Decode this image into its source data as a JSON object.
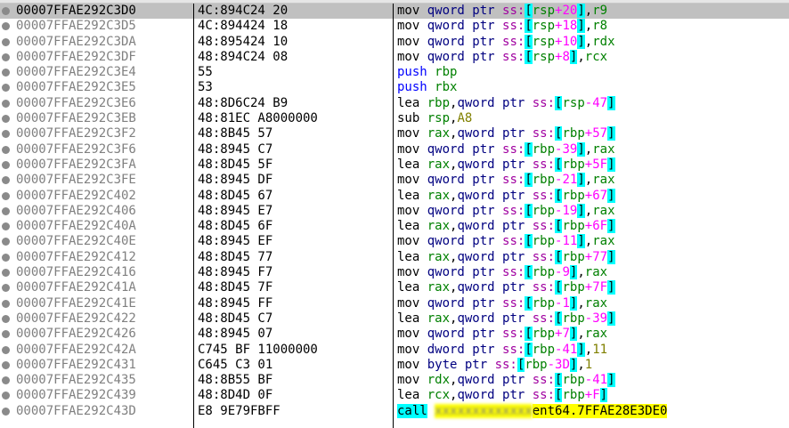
{
  "rows": [
    {
      "addr": "00007FFAE292C3D0",
      "bytes": "4C:894C24 20",
      "instr": [
        [
          "op-mov",
          "mov "
        ],
        [
          "kw",
          "qword ptr "
        ],
        [
          "seg",
          "ss:"
        ],
        [
          "br",
          "["
        ],
        [
          "reg",
          "rsp"
        ],
        [
          "off",
          "+20"
        ],
        [
          "br",
          "]"
        ],
        [
          "",
          ","
        ],
        [
          "reg",
          "r9"
        ]
      ],
      "selected": true
    },
    {
      "addr": "00007FFAE292C3D5",
      "bytes": "4C:894424 18",
      "instr": [
        [
          "op-mov",
          "mov "
        ],
        [
          "kw",
          "qword ptr "
        ],
        [
          "seg",
          "ss:"
        ],
        [
          "br",
          "["
        ],
        [
          "reg",
          "rsp"
        ],
        [
          "off",
          "+18"
        ],
        [
          "br",
          "]"
        ],
        [
          "",
          ","
        ],
        [
          "reg",
          "r8"
        ]
      ]
    },
    {
      "addr": "00007FFAE292C3DA",
      "bytes": "48:895424 10",
      "instr": [
        [
          "op-mov",
          "mov "
        ],
        [
          "kw",
          "qword ptr "
        ],
        [
          "seg",
          "ss:"
        ],
        [
          "br",
          "["
        ],
        [
          "reg",
          "rsp"
        ],
        [
          "off",
          "+10"
        ],
        [
          "br",
          "]"
        ],
        [
          "",
          ","
        ],
        [
          "reg",
          "rdx"
        ]
      ]
    },
    {
      "addr": "00007FFAE292C3DF",
      "bytes": "48:894C24 08",
      "instr": [
        [
          "op-mov",
          "mov "
        ],
        [
          "kw",
          "qword ptr "
        ],
        [
          "seg",
          "ss:"
        ],
        [
          "br",
          "["
        ],
        [
          "reg",
          "rsp"
        ],
        [
          "off",
          "+8"
        ],
        [
          "br",
          "]"
        ],
        [
          "",
          ","
        ],
        [
          "reg",
          "rcx"
        ]
      ]
    },
    {
      "addr": "00007FFAE292C3E4",
      "bytes": "55",
      "instr": [
        [
          "op-push",
          "push "
        ],
        [
          "reg",
          "rbp"
        ]
      ]
    },
    {
      "addr": "00007FFAE292C3E5",
      "bytes": "53",
      "instr": [
        [
          "op-push",
          "push "
        ],
        [
          "reg",
          "rbx"
        ]
      ]
    },
    {
      "addr": "00007FFAE292C3E6",
      "bytes": "48:8D6C24 B9",
      "instr": [
        [
          "op-mov",
          "lea "
        ],
        [
          "reg",
          "rbp"
        ],
        [
          "",
          ","
        ],
        [
          "kw",
          "qword ptr "
        ],
        [
          "seg",
          "ss:"
        ],
        [
          "br",
          "["
        ],
        [
          "reg",
          "rsp"
        ],
        [
          "off",
          "-47"
        ],
        [
          "br",
          "]"
        ]
      ]
    },
    {
      "addr": "00007FFAE292C3EB",
      "bytes": "48:81EC A8000000",
      "instr": [
        [
          "op-mov",
          "sub "
        ],
        [
          "reg",
          "rsp"
        ],
        [
          "",
          ","
        ],
        [
          "imm",
          "A8"
        ]
      ]
    },
    {
      "addr": "00007FFAE292C3F2",
      "bytes": "48:8B45 57",
      "instr": [
        [
          "op-mov",
          "mov "
        ],
        [
          "reg",
          "rax"
        ],
        [
          "",
          ","
        ],
        [
          "kw",
          "qword ptr "
        ],
        [
          "seg",
          "ss:"
        ],
        [
          "br",
          "["
        ],
        [
          "reg",
          "rbp"
        ],
        [
          "off",
          "+57"
        ],
        [
          "br",
          "]"
        ]
      ]
    },
    {
      "addr": "00007FFAE292C3F6",
      "bytes": "48:8945 C7",
      "instr": [
        [
          "op-mov",
          "mov "
        ],
        [
          "kw",
          "qword ptr "
        ],
        [
          "seg",
          "ss:"
        ],
        [
          "br",
          "["
        ],
        [
          "reg",
          "rbp"
        ],
        [
          "off",
          "-39"
        ],
        [
          "br",
          "]"
        ],
        [
          "",
          ","
        ],
        [
          "reg",
          "rax"
        ]
      ]
    },
    {
      "addr": "00007FFAE292C3FA",
      "bytes": "48:8D45 5F",
      "instr": [
        [
          "op-mov",
          "lea "
        ],
        [
          "reg",
          "rax"
        ],
        [
          "",
          ","
        ],
        [
          "kw",
          "qword ptr "
        ],
        [
          "seg",
          "ss:"
        ],
        [
          "br",
          "["
        ],
        [
          "reg",
          "rbp"
        ],
        [
          "off",
          "+5F"
        ],
        [
          "br",
          "]"
        ]
      ]
    },
    {
      "addr": "00007FFAE292C3FE",
      "bytes": "48:8945 DF",
      "instr": [
        [
          "op-mov",
          "mov "
        ],
        [
          "kw",
          "qword ptr "
        ],
        [
          "seg",
          "ss:"
        ],
        [
          "br",
          "["
        ],
        [
          "reg",
          "rbp"
        ],
        [
          "off",
          "-21"
        ],
        [
          "br",
          "]"
        ],
        [
          "",
          ","
        ],
        [
          "reg",
          "rax"
        ]
      ]
    },
    {
      "addr": "00007FFAE292C402",
      "bytes": "48:8D45 67",
      "instr": [
        [
          "op-mov",
          "lea "
        ],
        [
          "reg",
          "rax"
        ],
        [
          "",
          ","
        ],
        [
          "kw",
          "qword ptr "
        ],
        [
          "seg",
          "ss:"
        ],
        [
          "br",
          "["
        ],
        [
          "reg",
          "rbp"
        ],
        [
          "off",
          "+67"
        ],
        [
          "br",
          "]"
        ]
      ]
    },
    {
      "addr": "00007FFAE292C406",
      "bytes": "48:8945 E7",
      "instr": [
        [
          "op-mov",
          "mov "
        ],
        [
          "kw",
          "qword ptr "
        ],
        [
          "seg",
          "ss:"
        ],
        [
          "br",
          "["
        ],
        [
          "reg",
          "rbp"
        ],
        [
          "off",
          "-19"
        ],
        [
          "br",
          "]"
        ],
        [
          "",
          ","
        ],
        [
          "reg",
          "rax"
        ]
      ]
    },
    {
      "addr": "00007FFAE292C40A",
      "bytes": "48:8D45 6F",
      "instr": [
        [
          "op-mov",
          "lea "
        ],
        [
          "reg",
          "rax"
        ],
        [
          "",
          ","
        ],
        [
          "kw",
          "qword ptr "
        ],
        [
          "seg",
          "ss:"
        ],
        [
          "br",
          "["
        ],
        [
          "reg",
          "rbp"
        ],
        [
          "off",
          "+6F"
        ],
        [
          "br",
          "]"
        ]
      ]
    },
    {
      "addr": "00007FFAE292C40E",
      "bytes": "48:8945 EF",
      "instr": [
        [
          "op-mov",
          "mov "
        ],
        [
          "kw",
          "qword ptr "
        ],
        [
          "seg",
          "ss:"
        ],
        [
          "br",
          "["
        ],
        [
          "reg",
          "rbp"
        ],
        [
          "off",
          "-11"
        ],
        [
          "br",
          "]"
        ],
        [
          "",
          ","
        ],
        [
          "reg",
          "rax"
        ]
      ]
    },
    {
      "addr": "00007FFAE292C412",
      "bytes": "48:8D45 77",
      "instr": [
        [
          "op-mov",
          "lea "
        ],
        [
          "reg",
          "rax"
        ],
        [
          "",
          ","
        ],
        [
          "kw",
          "qword ptr "
        ],
        [
          "seg",
          "ss:"
        ],
        [
          "br",
          "["
        ],
        [
          "reg",
          "rbp"
        ],
        [
          "off",
          "+77"
        ],
        [
          "br",
          "]"
        ]
      ]
    },
    {
      "addr": "00007FFAE292C416",
      "bytes": "48:8945 F7",
      "instr": [
        [
          "op-mov",
          "mov "
        ],
        [
          "kw",
          "qword ptr "
        ],
        [
          "seg",
          "ss:"
        ],
        [
          "br",
          "["
        ],
        [
          "reg",
          "rbp"
        ],
        [
          "off",
          "-9"
        ],
        [
          "br",
          "]"
        ],
        [
          "",
          ","
        ],
        [
          "reg",
          "rax"
        ]
      ]
    },
    {
      "addr": "00007FFAE292C41A",
      "bytes": "48:8D45 7F",
      "instr": [
        [
          "op-mov",
          "lea "
        ],
        [
          "reg",
          "rax"
        ],
        [
          "",
          ","
        ],
        [
          "kw",
          "qword ptr "
        ],
        [
          "seg",
          "ss:"
        ],
        [
          "br",
          "["
        ],
        [
          "reg",
          "rbp"
        ],
        [
          "off",
          "+7F"
        ],
        [
          "br",
          "]"
        ]
      ]
    },
    {
      "addr": "00007FFAE292C41E",
      "bytes": "48:8945 FF",
      "instr": [
        [
          "op-mov",
          "mov "
        ],
        [
          "kw",
          "qword ptr "
        ],
        [
          "seg",
          "ss:"
        ],
        [
          "br",
          "["
        ],
        [
          "reg",
          "rbp"
        ],
        [
          "off",
          "-1"
        ],
        [
          "br",
          "]"
        ],
        [
          "",
          ","
        ],
        [
          "reg",
          "rax"
        ]
      ]
    },
    {
      "addr": "00007FFAE292C422",
      "bytes": "48:8D45 C7",
      "instr": [
        [
          "op-mov",
          "lea "
        ],
        [
          "reg",
          "rax"
        ],
        [
          "",
          ","
        ],
        [
          "kw",
          "qword ptr "
        ],
        [
          "seg",
          "ss:"
        ],
        [
          "br",
          "["
        ],
        [
          "reg",
          "rbp"
        ],
        [
          "off",
          "-39"
        ],
        [
          "br",
          "]"
        ]
      ]
    },
    {
      "addr": "00007FFAE292C426",
      "bytes": "48:8945 07",
      "instr": [
        [
          "op-mov",
          "mov "
        ],
        [
          "kw",
          "qword ptr "
        ],
        [
          "seg",
          "ss:"
        ],
        [
          "br",
          "["
        ],
        [
          "reg",
          "rbp"
        ],
        [
          "off",
          "+7"
        ],
        [
          "br",
          "]"
        ],
        [
          "",
          ","
        ],
        [
          "reg",
          "rax"
        ]
      ]
    },
    {
      "addr": "00007FFAE292C42A",
      "bytes": "C745 BF 11000000",
      "instr": [
        [
          "op-mov",
          "mov "
        ],
        [
          "kw",
          "dword ptr "
        ],
        [
          "seg",
          "ss:"
        ],
        [
          "br",
          "["
        ],
        [
          "reg",
          "rbp"
        ],
        [
          "off",
          "-41"
        ],
        [
          "br",
          "]"
        ],
        [
          "",
          ","
        ],
        [
          "imm",
          "11"
        ]
      ]
    },
    {
      "addr": "00007FFAE292C431",
      "bytes": "C645 C3 01",
      "instr": [
        [
          "op-mov",
          "mov "
        ],
        [
          "kw",
          "byte ptr "
        ],
        [
          "seg",
          "ss:"
        ],
        [
          "br",
          "["
        ],
        [
          "reg",
          "rbp"
        ],
        [
          "off",
          "-3D"
        ],
        [
          "br",
          "]"
        ],
        [
          "",
          ","
        ],
        [
          "imm",
          "1"
        ]
      ]
    },
    {
      "addr": "00007FFAE292C435",
      "bytes": "48:8B55 BF",
      "instr": [
        [
          "op-mov",
          "mov "
        ],
        [
          "reg",
          "rdx"
        ],
        [
          "",
          ","
        ],
        [
          "kw",
          "qword ptr "
        ],
        [
          "seg",
          "ss:"
        ],
        [
          "br",
          "["
        ],
        [
          "reg",
          "rbp"
        ],
        [
          "off",
          "-41"
        ],
        [
          "br",
          "]"
        ]
      ]
    },
    {
      "addr": "00007FFAE292C439",
      "bytes": "48:8D4D 0F",
      "instr": [
        [
          "op-mov",
          "lea "
        ],
        [
          "reg",
          "rcx"
        ],
        [
          "",
          ","
        ],
        [
          "kw",
          "qword ptr "
        ],
        [
          "seg",
          "ss:"
        ],
        [
          "br",
          "["
        ],
        [
          "reg",
          "rbp"
        ],
        [
          "off",
          "+F"
        ],
        [
          "br",
          "]"
        ]
      ]
    },
    {
      "addr": "00007FFAE292C43D",
      "bytes": "E8 9E79FBFF",
      "instr": [
        [
          "op-call",
          "call"
        ],
        [
          "",
          " "
        ],
        [
          "blur",
          "xxxxxxxxxxxxx"
        ],
        [
          "hl",
          "ent64.7FFAE28E3DE0"
        ]
      ]
    }
  ]
}
